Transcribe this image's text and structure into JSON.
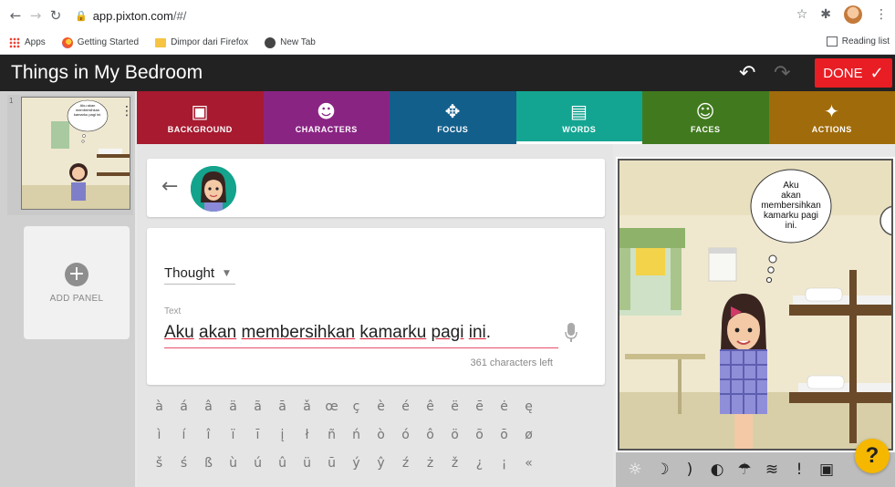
{
  "browser": {
    "url_host": "app.pixton.com",
    "url_path": "/#/",
    "bookmarks": [
      {
        "label": "Apps"
      },
      {
        "label": "Getting Started"
      },
      {
        "label": "Dimpor dari Firefox"
      },
      {
        "label": "New Tab"
      }
    ],
    "reading_list": "Reading list"
  },
  "app": {
    "title": "Things in My Bedroom",
    "done_label": "DONE"
  },
  "sidebar": {
    "panel_number": "1",
    "thumb_bubble_text": "Aku akan membersihkan kamarku pagi ini.",
    "add_panel_label": "ADD PANEL"
  },
  "tabs": [
    {
      "label": "BACKGROUND",
      "color": "#a71a2f",
      "icon": "image-icon"
    },
    {
      "label": "CHARACTERS",
      "color": "#8a2483",
      "icon": "face-icon"
    },
    {
      "label": "FOCUS",
      "color": "#135f8c",
      "icon": "move-icon"
    },
    {
      "label": "WORDS",
      "color": "#14a592",
      "icon": "speech-icon",
      "active": true
    },
    {
      "label": "FACES",
      "color": "#417a1e",
      "icon": "smile-icon"
    },
    {
      "label": "ACTIONS",
      "color": "#a06b0a",
      "icon": "run-icon"
    }
  ],
  "editor": {
    "bubble_type": "Thought",
    "text_label": "Text",
    "text_words": [
      "Aku",
      "akan",
      "membersihkan",
      "kamarku",
      "pagi",
      "ini"
    ],
    "text_end": ".",
    "chars_left": "361 characters left"
  },
  "special_chars": [
    [
      "à",
      "á",
      "â",
      "ä",
      "ã",
      "ā",
      "ǎ",
      "œ",
      "ç",
      "è",
      "é",
      "ê",
      "ë",
      "ē",
      "ė",
      "ę"
    ],
    [
      "ì",
      "í",
      "î",
      "ï",
      "ī",
      "į",
      "ł",
      "ñ",
      "ń",
      "ò",
      "ó",
      "ô",
      "ö",
      "õ",
      "ō",
      "ø"
    ],
    [
      "š",
      "ś",
      "ß",
      "ù",
      "ú",
      "û",
      "ü",
      "ū",
      "ý",
      "ŷ",
      "ź",
      "ż",
      "ž",
      "¿",
      "¡",
      "«"
    ]
  ],
  "preview": {
    "bubble_lines": [
      "Aku",
      "akan",
      "membersihkan",
      "kamarku pagi",
      "ini."
    ]
  },
  "help_label": "?"
}
